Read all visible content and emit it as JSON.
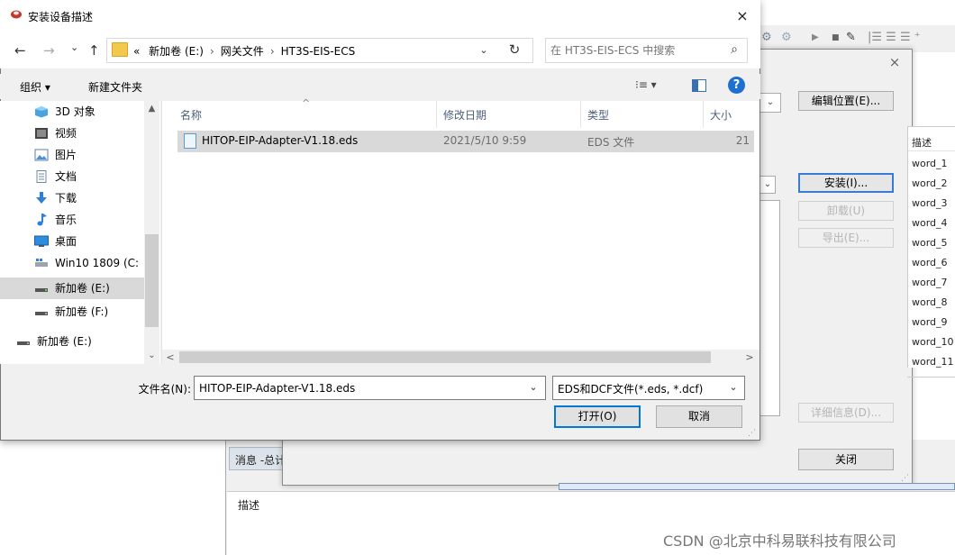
{
  "colors": {
    "accent": "#0078d7",
    "selection": "#d9d9d9",
    "help": "#1e6fcf",
    "folder": "#f2c94c"
  },
  "background_window": {
    "toolbar_icons": [
      "gear-icon",
      "gear-icon",
      "play-icon",
      "stop-icon",
      "tool-icon",
      "list-icon"
    ],
    "message_tab": "消息 -总计",
    "description_label": "描述"
  },
  "repository_dialog": {
    "close_glyph": "×",
    "edit_location_button": "编辑位置(E)...",
    "install_button": "安装(I)...",
    "uninstall_button": "卸载(U)",
    "export_button": "导出(E)...",
    "details_button": "详细信息(D)...",
    "close_button": "关闭",
    "table_header": "描述",
    "table_rows": [
      "word_1",
      "word_2",
      "word_3",
      "word_4",
      "word_5",
      "word_6",
      "word_7",
      "word_8",
      "word_9",
      "word_10",
      "word_11"
    ]
  },
  "file_dialog": {
    "title": "安装设备描述",
    "close_glyph": "×",
    "nav": {
      "back": "←",
      "forward": "→",
      "recent": "⌄",
      "up": "↑"
    },
    "breadcrumb": {
      "overflow": "«",
      "items": [
        "新加卷 (E:)",
        "网关文件",
        "HT3S-EIS-ECS"
      ],
      "separator": "›"
    },
    "address_dropdown": "⌄",
    "refresh": "↻",
    "search": {
      "placeholder": "在 HT3S-EIS-ECS 中搜索",
      "icon": "⌕"
    },
    "toolbar": {
      "organize": "组织 ▾",
      "new_folder": "新建文件夹",
      "view_mode": "⁝≡ ▾",
      "help": "?"
    },
    "nav_pane": [
      {
        "label": "3D 对象",
        "icon": "cube-icon"
      },
      {
        "label": "视频",
        "icon": "video-icon"
      },
      {
        "label": "图片",
        "icon": "picture-icon"
      },
      {
        "label": "文档",
        "icon": "document-icon"
      },
      {
        "label": "下载",
        "icon": "download-icon"
      },
      {
        "label": "音乐",
        "icon": "music-icon"
      },
      {
        "label": "桌面",
        "icon": "desktop-icon"
      },
      {
        "label": "Win10 1809 (C:",
        "icon": "system-drive-icon"
      },
      {
        "label": "新加卷 (E:)",
        "icon": "drive-icon",
        "selected": true
      },
      {
        "label": "新加卷 (F:)",
        "icon": "drive-icon"
      },
      {
        "label": "新加卷 (E:)",
        "icon": "drive-icon"
      }
    ],
    "columns": {
      "name": "名称",
      "date": "修改日期",
      "type": "类型",
      "size": "大小",
      "sort_indicator": "^"
    },
    "files": [
      {
        "name": "HITOP-EIP-Adapter-V1.18.eds",
        "date": "2021/5/10 9:59",
        "type": "EDS 文件",
        "size": "21"
      }
    ],
    "scroll": {
      "up": "▲",
      "down": "⌄",
      "left": "<",
      "right": ">"
    },
    "filename_label": "文件名(N):",
    "filename_value": "HITOP-EIP-Adapter-V1.18.eds",
    "filter_value": "EDS和DCF文件(*.eds, *.dcf)",
    "dropdown_glyph": "⌄",
    "open_button": "打开(O)",
    "cancel_button": "取消"
  },
  "watermark": "CSDN @北京中科易联科技有限公司"
}
